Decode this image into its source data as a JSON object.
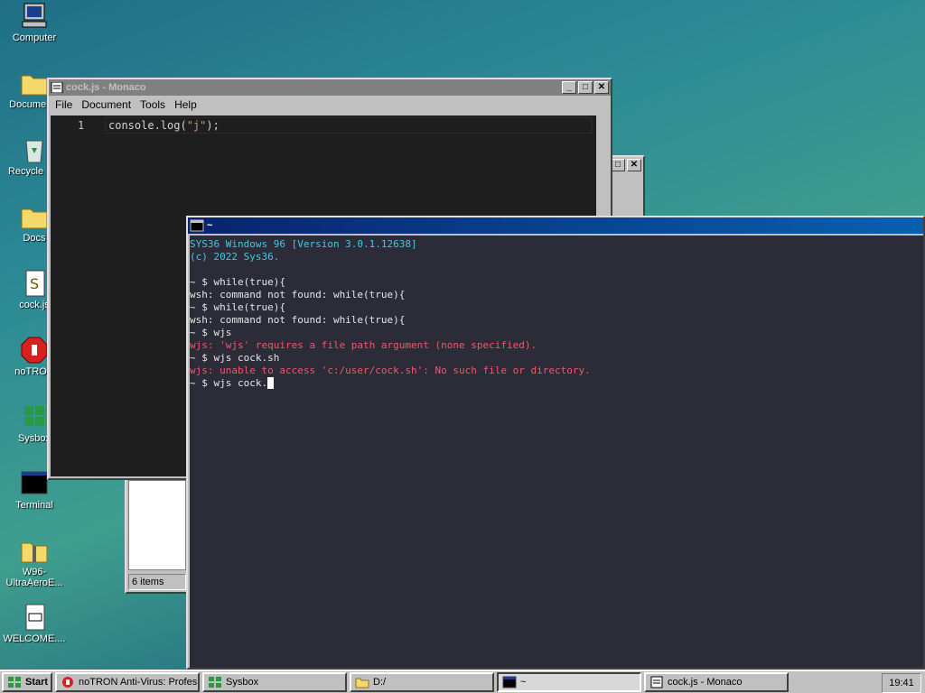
{
  "desktop": {
    "icons": [
      {
        "label": "Computer"
      },
      {
        "label": "Documents"
      },
      {
        "label": "Recycle Bin"
      },
      {
        "label": "Docs"
      },
      {
        "label": "cock.js"
      },
      {
        "label": "noTRON"
      },
      {
        "label": "Sysbox"
      },
      {
        "label": "Terminal"
      },
      {
        "label": "W96-UltraAeroE..."
      },
      {
        "label": "WELCOME...."
      }
    ]
  },
  "editor_window": {
    "title": "cock.js - Monaco",
    "menu": [
      "File",
      "Document",
      "Tools",
      "Help"
    ],
    "line_number": "1",
    "code_prefix": "console.log(",
    "code_string": "\"j\"",
    "code_suffix": ");"
  },
  "explorer_window": {
    "status": "6 items"
  },
  "terminal": {
    "title": "~",
    "lines": [
      {
        "text": "SYS36 Windows 96 [Version 3.0.1.12638]",
        "color": "cyan"
      },
      {
        "text": "(c) 2022 Sys36.",
        "color": "cyan"
      },
      {
        "text": "",
        "color": "white"
      },
      {
        "text": "~ $ while(true){",
        "color": "white"
      },
      {
        "text": "wsh: command not found: while(true){",
        "color": "white"
      },
      {
        "text": "~ $ while(true){",
        "color": "white"
      },
      {
        "text": "wsh: command not found: while(true){",
        "color": "white"
      },
      {
        "text": "~ $ wjs",
        "color": "white"
      },
      {
        "text": "wjs: 'wjs' requires a file path argument (none specified).",
        "color": "red"
      },
      {
        "text": "~ $ wjs cock.sh",
        "color": "white"
      },
      {
        "text": "wjs: unable to access 'c:/user/cock.sh': No such file or directory.",
        "color": "red"
      },
      {
        "text": "~ $ wjs cock.",
        "color": "white"
      }
    ]
  },
  "taskbar": {
    "start_label": "Start",
    "items": [
      {
        "label": "noTRON Anti-Virus: Profes...",
        "active": false
      },
      {
        "label": "Sysbox",
        "active": false
      },
      {
        "label": "D:/",
        "active": false
      },
      {
        "label": "~",
        "active": true
      },
      {
        "label": "cock.js - Monaco",
        "active": false
      }
    ],
    "clock": "19:41"
  }
}
